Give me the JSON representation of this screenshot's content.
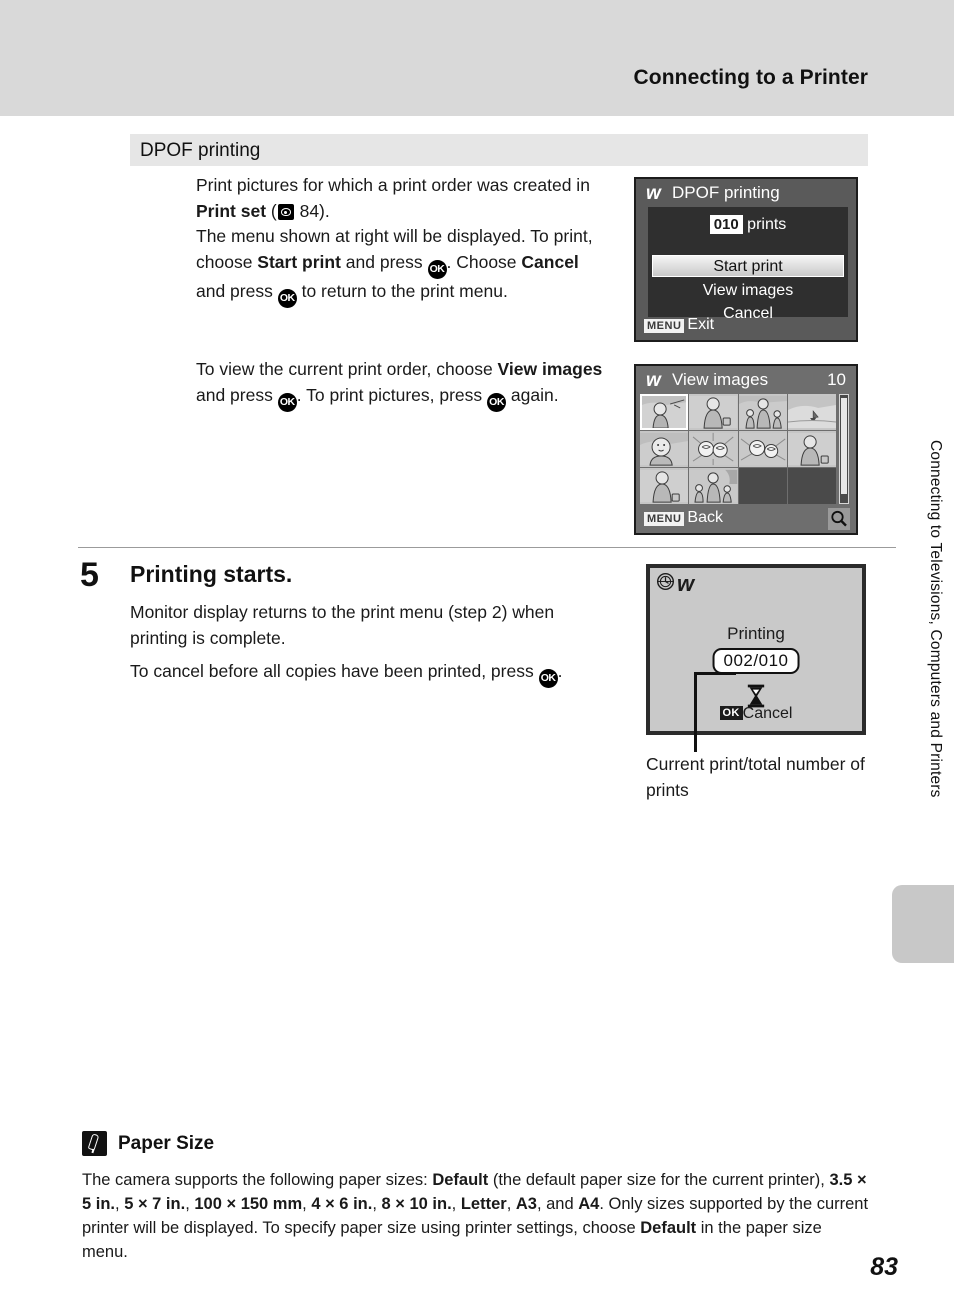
{
  "header": {
    "title": "Connecting to a Printer"
  },
  "section": {
    "label": "DPOF printing"
  },
  "body": {
    "p1_a": "Print pictures for which a print order was created in ",
    "p1_print_set": "Print set",
    "p1_b": " (",
    "p1_page": " 84).",
    "p1_c": "The menu shown at right will be displayed. To print, choose ",
    "p1_start_print": "Start print",
    "p1_d": " and press ",
    "p1_ok1": "OK",
    "p1_e": ". Choose ",
    "p1_cancel": "Cancel",
    "p1_f": " and press ",
    "p1_ok2": "OK",
    "p1_g": " to return to the print menu.",
    "p2_a": "To view the current print order, choose ",
    "p2_view_images": "View images",
    "p2_b": " and press ",
    "p2_ok1": "OK",
    "p2_c": ". To print pictures, press ",
    "p2_ok2": "OK",
    "p2_d": " again."
  },
  "step5": {
    "number": "5",
    "title": "Printing starts.",
    "para1": "Monitor display returns to the print menu (step 2) when printing is complete.",
    "para2_a": "To cancel before all copies have been printed, press ",
    "para2_ok": "OK",
    "para2_b": "."
  },
  "screen_dpof": {
    "title": "DPOF printing",
    "prints_count": "010",
    "prints_label": "prints",
    "items": [
      {
        "label": "Start print",
        "selected": true
      },
      {
        "label": "View images",
        "selected": false
      },
      {
        "label": "Cancel",
        "selected": false
      }
    ],
    "footer_badge": "MENU",
    "footer_label": "Exit"
  },
  "screen_view_images": {
    "title": "View images",
    "count": "10",
    "total_cells": 12,
    "filled_cells": 10,
    "selected_index": 0,
    "footer_badge": "MENU",
    "footer_label": "Back",
    "magnifier_icon": "magnifier-icon"
  },
  "screen_printing": {
    "printing_label": "Printing",
    "counter": "002/010",
    "hourglass_icon": "hourglass-icon",
    "cancel_badge": "OK",
    "cancel_label": "Cancel",
    "clock_icon": "clock-icon",
    "pictbridge_icon": "pictbridge-icon"
  },
  "callout": {
    "caption": "Current print/total number of prints"
  },
  "side_tab": {
    "text": "Connecting to Televisions, Computers and Printers"
  },
  "note": {
    "icon": "pencil-note-icon",
    "title": "Paper Size",
    "a": "The camera supports the following paper sizes: ",
    "default1": "Default",
    "b": " (the default paper size for the current printer), ",
    "s1": "3.5 × 5 in.",
    "c1": ", ",
    "s2": "5 × 7 in.",
    "c2": ", ",
    "s3": "100 × 150 mm",
    "c3": ", ",
    "s4": "4 × 6 in.",
    "c4": ", ",
    "s5": "8 × 10 in.",
    "c5": ", ",
    "s6": "Letter",
    "c6": ", ",
    "s7": "A3",
    "c7": ", and ",
    "s8": "A4",
    "d": ". Only sizes supported by the current printer will be displayed. To specify paper size using printer settings, choose ",
    "default2": "Default",
    "e": " in the paper size menu."
  },
  "page_number": "83",
  "colors": {
    "header_band": "#d9d9d9",
    "section_band": "#e6e6e6",
    "side_tab": "#c8c8c8"
  }
}
